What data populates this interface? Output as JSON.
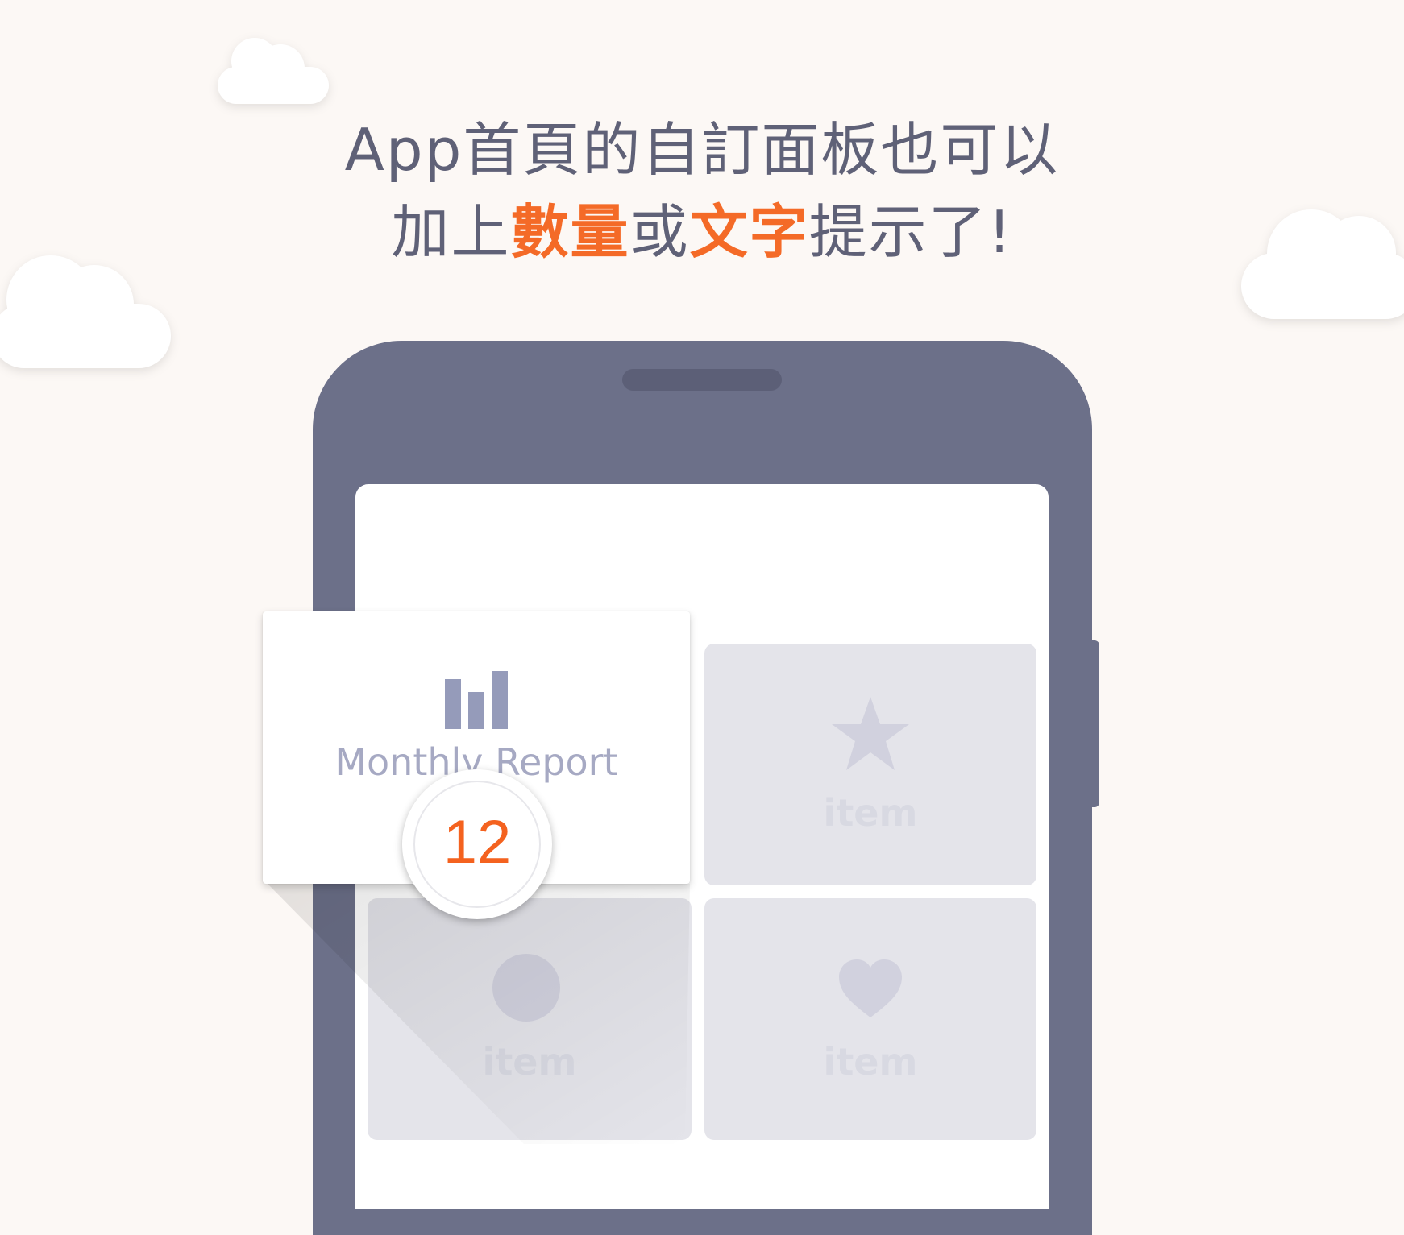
{
  "headline": {
    "line1": "App首頁的自訂面板也可以",
    "line2_part1": "加上",
    "line2_highlight1": "數量",
    "line2_part2": "或",
    "line2_highlight2": "文字",
    "line2_part3": "提示了!"
  },
  "colors": {
    "background": "#fcf8f5",
    "headline_text": "#5f6177",
    "highlight": "#f46a27",
    "phone_body": "#6c7089",
    "tile_bg": "#e4e4ea",
    "badge_number": "#f4621f"
  },
  "featured_card": {
    "icon": "bar-chart-icon",
    "title": "Monthly Report",
    "badge_count": "12"
  },
  "tiles": [
    {
      "icon": "star-icon",
      "label": "item"
    },
    {
      "icon": "circle-icon",
      "label": "item"
    },
    {
      "icon": "heart-icon",
      "label": "item"
    }
  ]
}
